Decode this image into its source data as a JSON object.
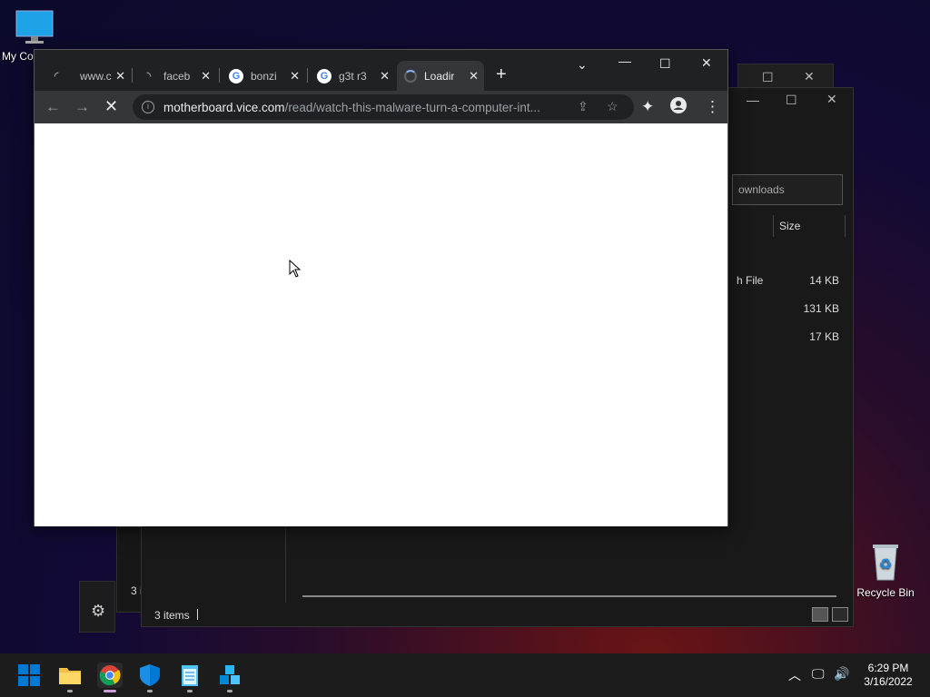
{
  "desktop": {
    "my_computer": "My Co",
    "recycle_bin": "Recycle Bin"
  },
  "explorer": {
    "search_placeholder": "ownloads",
    "col_size": "Size",
    "rows": [
      {
        "type": "h File",
        "size": "14 KB"
      },
      {
        "type": "",
        "size": "131 KB"
      },
      {
        "type": "",
        "size": "17 KB"
      }
    ],
    "status": "3 items",
    "back_status": "3 i"
  },
  "chrome": {
    "tabs": [
      {
        "title": "www.c",
        "fav": "loading"
      },
      {
        "title": "faceb",
        "fav": "loading"
      },
      {
        "title": "bonzi",
        "fav": "google"
      },
      {
        "title": "g3t r3",
        "fav": "google"
      },
      {
        "title": "Loadir",
        "fav": "spinner",
        "active": true
      }
    ],
    "url_domain": "motherboard.vice.com",
    "url_path": "/read/watch-this-malware-turn-a-computer-int...",
    "icons": [
      "back-arrow-icon",
      "forward-arrow-icon",
      "stop-loading-icon",
      "share-icon",
      "star-icon",
      "extensions-icon",
      "profile-icon",
      "menu-icon"
    ]
  },
  "taskbar": {
    "time": "6:29 PM",
    "date": "3/16/2022"
  },
  "colors": {
    "chrome_dark": "#202124",
    "chrome_toolbar": "#35363a",
    "taskbar": "#1c1c1c",
    "win_blue": "#0078d4"
  }
}
